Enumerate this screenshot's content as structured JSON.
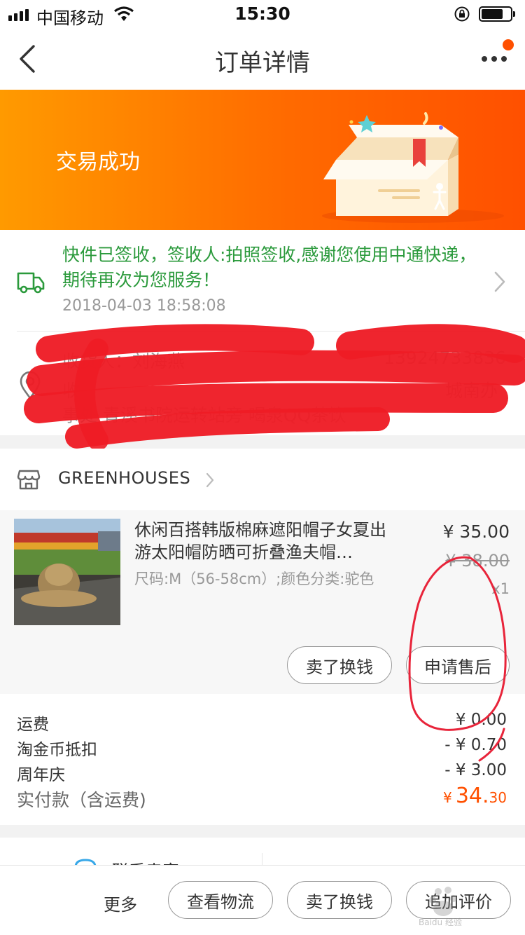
{
  "status_bar": {
    "carrier": "中国移动",
    "time": "15:30"
  },
  "nav": {
    "title": "订单详情"
  },
  "banner": {
    "status_text": "交易成功"
  },
  "logistics": {
    "message": "快件已签收，签收人:拍照签收,感谢您使用中通快递，期待再次为您服务！",
    "time": "2018-04-03 18:58:08"
  },
  "address": {
    "receiver_line": "收货人：刘海燕",
    "phone": "13924733836",
    "address_line_1_start": "收",
    "address_line_1_end": "城南办",
    "address_line_2": "事处 青溪书院运转站旁 喝泉QQ茶饮"
  },
  "shop": {
    "name": "GREENHOUSES"
  },
  "item": {
    "title": "休闲百搭韩版棉麻遮阳帽子女夏出游太阳帽防晒可折叠渔夫帽…",
    "spec": "尺码:M（56-58cm）;颜色分类:驼色",
    "price": "¥ 35.00",
    "original_price": "¥ 38.00",
    "quantity": "x1",
    "actions": [
      "卖了换钱",
      "申请售后"
    ]
  },
  "fees": [
    {
      "label": "运费",
      "value": "¥ 0.00"
    },
    {
      "label": "淘金币抵扣",
      "value": "- ¥ 0.70"
    },
    {
      "label": "周年庆",
      "value": "- ¥ 3.00"
    }
  ],
  "total": {
    "label": "实付款（含运费)",
    "currency": "¥",
    "amount_int": "34.",
    "amount_dec": "30"
  },
  "contact": {
    "label": "联系卖家"
  },
  "bottom_bar": {
    "more": "更多",
    "buttons": [
      "查看物流",
      "卖了换钱",
      "追加评价"
    ]
  },
  "colors": {
    "accent": "#ff5000",
    "banner_start": "#ff9a00",
    "logistics_green": "#2b9a3c",
    "annotation_red": "#e8243a"
  },
  "watermark": {
    "text": "Baidu 经验"
  }
}
